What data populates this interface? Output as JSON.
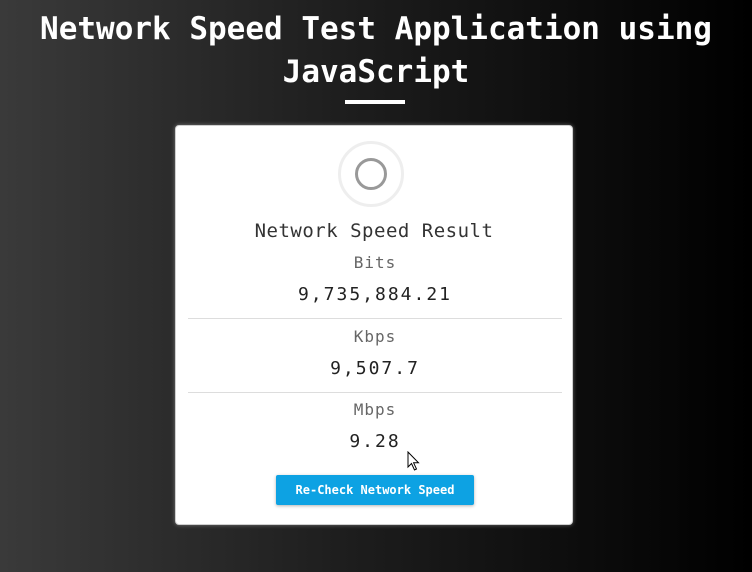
{
  "page": {
    "title": "Network Speed Test Application using JavaScript"
  },
  "result": {
    "heading": "Network Speed Result",
    "units": [
      {
        "label": "Bits",
        "value": "9,735,884.21"
      },
      {
        "label": "Kbps",
        "value": "9,507.7"
      },
      {
        "label": "Mbps",
        "value": "9.28"
      }
    ],
    "button_label": "Re-Check Network Speed"
  },
  "colors": {
    "accent": "#0da2e3",
    "card_background": "#ffffff",
    "title_text": "#ffffff"
  },
  "icons": {
    "loader": "loading-spinner-icon",
    "cursor": "mouse-pointer-icon"
  }
}
